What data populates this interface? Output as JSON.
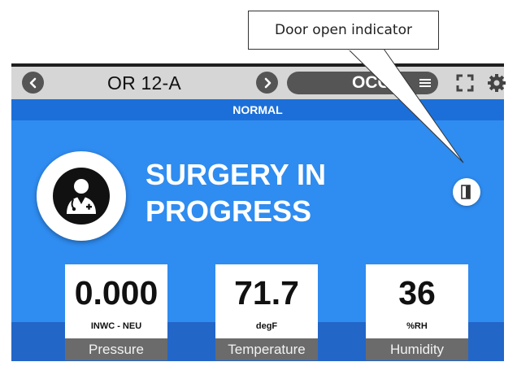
{
  "callout": {
    "text": "Door open indicator"
  },
  "topbar": {
    "room_name": "OR 12-A",
    "occupancy_label": "OCC"
  },
  "status": {
    "text": "NORMAL"
  },
  "main": {
    "title_line1": "SURGERY IN",
    "title_line2": "PROGRESS",
    "avatar_icon": "doctor-icon",
    "door_icon": "door-open-icon"
  },
  "readouts": [
    {
      "value": "0.000",
      "unit": "INWC - NEU",
      "label": "Pressure"
    },
    {
      "value": "71.7",
      "unit": "degF",
      "label": "Temperature"
    },
    {
      "value": "36",
      "unit": "%RH",
      "label": "Humidity"
    }
  ],
  "colors": {
    "panel_blue": "#2f8cf0",
    "strip_blue": "#1c6fd8",
    "band_blue": "#2266c8",
    "label_gray": "#6b6b6b",
    "topbar_gray": "#d6d6d6"
  }
}
